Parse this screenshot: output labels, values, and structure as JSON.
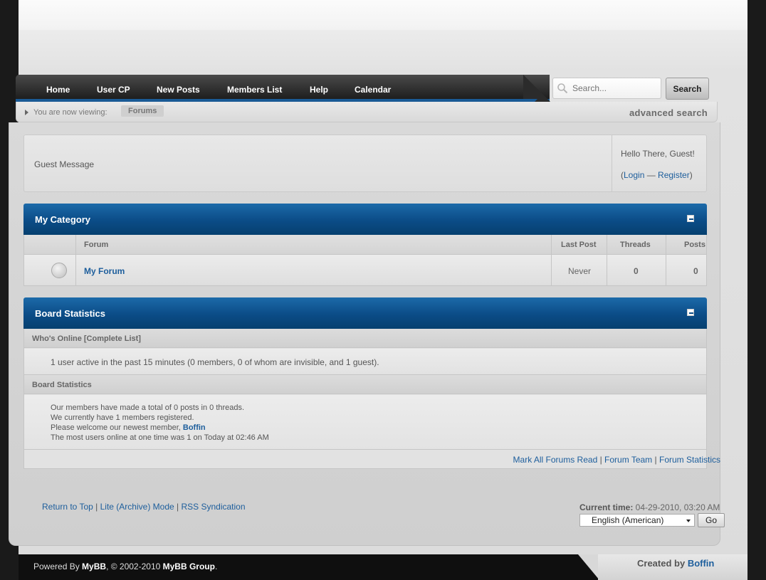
{
  "nav": {
    "items": [
      "Home",
      "User CP",
      "New Posts",
      "Members List",
      "Help",
      "Calendar"
    ],
    "search_placeholder": "Search...",
    "search_button": "Search"
  },
  "breadcrumb": {
    "prefix": "You are now viewing:",
    "current": "Forums",
    "advanced_search": "advanced search"
  },
  "guest": {
    "message": "Guest Message",
    "hello": "Hello There, Guest!",
    "login": "Login",
    "separator": " — ",
    "register": "Register"
  },
  "category": {
    "title": "My Category",
    "columns": [
      "Forum",
      "Last Post",
      "Threads",
      "Posts"
    ],
    "rows": [
      {
        "forum": "My Forum",
        "last_post": "Never",
        "threads": "0",
        "posts": "0"
      }
    ]
  },
  "board_stats": {
    "title": "Board Statistics",
    "whos_online_head": "Who's Online [Complete List]",
    "online_text": "1 user active in the past 15 minutes (0 members, 0 of whom are invisible, and 1 guest).",
    "stats_head": "Board Statistics",
    "line1": "Our members have made a total of 0 posts in 0 threads.",
    "line2": "We currently have 1 members registered.",
    "line3_prefix": "Please welcome our newest member, ",
    "newest_member": "Boffin",
    "line4": "The most users online at one time was 1 on Today at 02:46 AM",
    "links": [
      "Mark All Forums Read",
      "Forum Team",
      "Forum Statistics"
    ]
  },
  "footer": {
    "links": [
      "Return to Top",
      "Lite (Archive) Mode",
      "RSS Syndication"
    ],
    "current_time_label": "Current time:",
    "current_time": " 04-29-2010, 03:20 AM",
    "language": "English (American)",
    "go": "Go",
    "powered_prefix": "Powered By ",
    "mybb": "MyBB",
    "copyright": ", © 2002-2010 ",
    "mybb_group": "MyBB Group",
    "period": ".",
    "created_by": "Created by ",
    "creator": "Boffin"
  },
  "colors": {
    "accent_blue": "#0b4c87",
    "link_blue": "#1d5e9c",
    "nav_dark": "#2b2b2b"
  }
}
